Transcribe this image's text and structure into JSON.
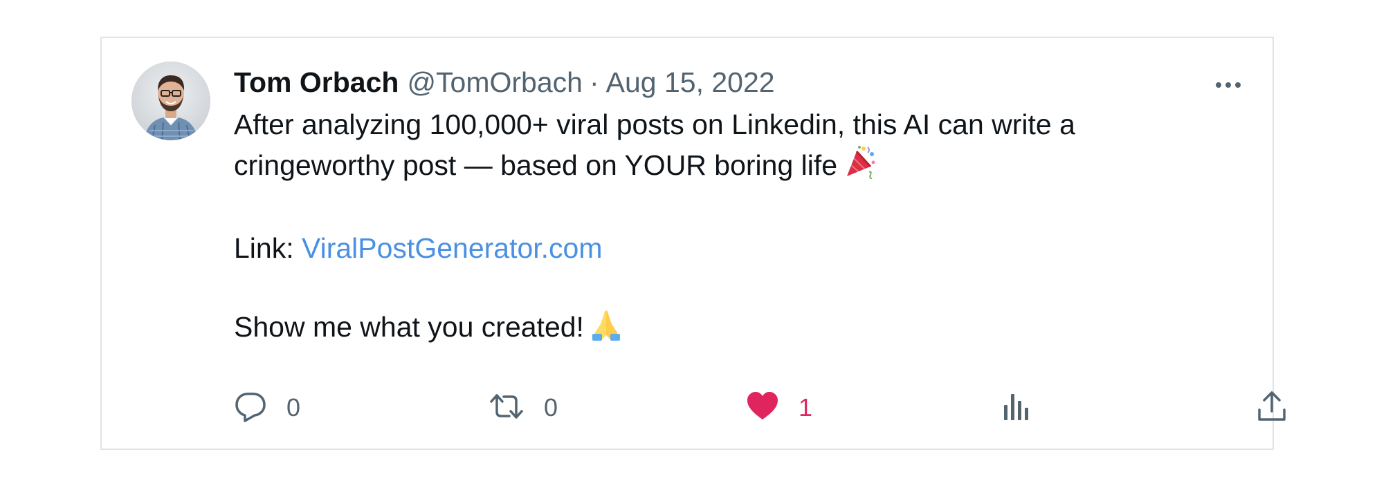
{
  "tweet": {
    "author": {
      "name": "Tom Orbach",
      "handle": "@TomOrbach"
    },
    "separator": "·",
    "date": "Aug 15, 2022",
    "body": {
      "line1": "After analyzing 100,000+ viral posts on Linkedin, this AI can write a",
      "line2": "cringeworthy post — based on YOUR boring life",
      "link_label": "Link: ",
      "link_text": "ViralPostGenerator.com",
      "closing": "Show me what you created!"
    },
    "icons": {
      "line2_emoji": "party-popper-icon",
      "closing_emoji": "folded-hands-icon",
      "more": "more-icon"
    },
    "actions": {
      "reply": {
        "icon": "reply-icon",
        "count": "0"
      },
      "retweet": {
        "icon": "retweet-icon",
        "count": "0"
      },
      "like": {
        "icon": "heart-icon",
        "count": "1",
        "active": true
      },
      "views": {
        "icon": "views-icon"
      },
      "share": {
        "icon": "share-icon"
      }
    },
    "colors": {
      "text": "#0f1419",
      "secondary": "#536471",
      "link": "#4a90e2",
      "like": "#e0245e",
      "border": "#e1e4e7"
    }
  }
}
